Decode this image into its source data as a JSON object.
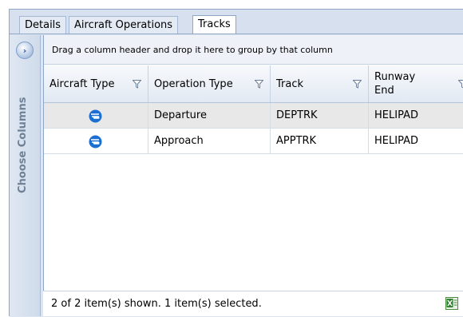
{
  "tabs": [
    {
      "label": "Details",
      "active": false
    },
    {
      "label": "Aircraft Operations",
      "active": false
    },
    {
      "label": "Tracks",
      "active": true
    }
  ],
  "side_panel": {
    "expand_icon": "chevron-right-icon",
    "label": "Choose Columns"
  },
  "grid": {
    "group_hint": "Drag a column header and drop it here to group by that column",
    "columns": [
      {
        "label": "Aircraft Type",
        "filter_icon": "filter-icon"
      },
      {
        "label": "Operation Type",
        "filter_icon": "filter-icon"
      },
      {
        "label": "Track",
        "filter_icon": "filter-icon"
      },
      {
        "label": "Runway End",
        "filter_icon": "filter-icon"
      }
    ],
    "rows": [
      {
        "aircraft_icon": "helicopter-icon",
        "operation": "Departure",
        "track": "DEPTRK",
        "runway_end": "HELIPAD",
        "selected": true
      },
      {
        "aircraft_icon": "helicopter-icon",
        "operation": "Approach",
        "track": "APPTRK",
        "runway_end": "HELIPAD",
        "selected": false
      }
    ]
  },
  "status": {
    "text": "2 of 2 item(s) shown. 1 item(s) selected.",
    "export_icon": "excel-export-icon"
  },
  "colors": {
    "accent": "#1b6fd0",
    "selected_row": "#e8e8e8",
    "frame": "#8fa6c4"
  }
}
